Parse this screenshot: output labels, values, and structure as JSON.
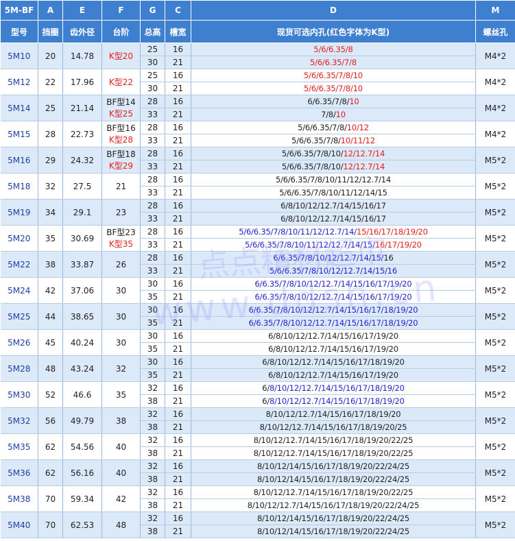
{
  "header_letters": [
    "5M-BF",
    "A",
    "E",
    "F",
    "G",
    "C",
    "D",
    "M"
  ],
  "header_names": [
    "型号",
    "挡圈",
    "齿外径",
    "台阶",
    "总高",
    "槽宽",
    "现货可选内孔(红色字体为K型)",
    "螺丝孔"
  ],
  "colors": {
    "header_bg": "#3f7fd0",
    "band_even": "#dce9f9",
    "band_odd": "#ffffff",
    "red": "#e31d1d",
    "blue": "#2222cc",
    "model": "#1f3fa8"
  },
  "watermark": {
    "line1": "点点精材超市",
    "line2": "www.ddsh.cn"
  },
  "groups": [
    {
      "model": "5M10",
      "a": "20",
      "e": "14.78",
      "f": [
        [
          "K型",
          "red"
        ],
        [
          "20",
          "red"
        ]
      ],
      "m": "M4*2",
      "rows": [
        {
          "g": "25",
          "c": "16",
          "d": [
            [
              "5/6/6.35/8",
              "red"
            ]
          ]
        },
        {
          "g": "30",
          "c": "21",
          "d": [
            [
              "5/6/6.35/7/8",
              "red"
            ]
          ]
        }
      ]
    },
    {
      "model": "5M12",
      "a": "22",
      "e": "17.96",
      "f": [
        [
          "K型",
          "red"
        ],
        [
          "22",
          "red"
        ]
      ],
      "m": "M4*2",
      "rows": [
        {
          "g": "25",
          "c": "16",
          "d": [
            [
              "5/6/6.35/7/8/10",
              "red"
            ]
          ]
        },
        {
          "g": "30",
          "c": "21",
          "d": [
            [
              "5/6/6.35/7/8/10",
              "red"
            ]
          ]
        }
      ]
    },
    {
      "model": "5M14",
      "a": "25",
      "e": "21.14",
      "f2": [
        [
          [
            "BF型14",
            "blk"
          ]
        ],
        [
          [
            "K型25",
            "red"
          ]
        ]
      ],
      "m": "M4*2",
      "rows": [
        {
          "g": "28",
          "c": "16",
          "d": [
            [
              "6/6.35/7/8/",
              "blk"
            ],
            [
              "10",
              "red"
            ]
          ]
        },
        {
          "g": "33",
          "c": "21",
          "d": [
            [
              "7/8/",
              "blk"
            ],
            [
              "10",
              "red"
            ]
          ]
        }
      ]
    },
    {
      "model": "5M15",
      "a": "28",
      "e": "22.73",
      "f2": [
        [
          [
            "BF型16",
            "blk"
          ]
        ],
        [
          [
            "K型28",
            "red"
          ]
        ]
      ],
      "m": "M4*2",
      "rows": [
        {
          "g": "28",
          "c": "16",
          "d": [
            [
              "5/6/6.35/7/8/",
              "blk"
            ],
            [
              "10/12",
              "red"
            ]
          ]
        },
        {
          "g": "33",
          "c": "21",
          "d": [
            [
              "5/6/6.35/7/8/",
              "blk"
            ],
            [
              "10/11/12",
              "red"
            ]
          ]
        }
      ]
    },
    {
      "model": "5M16",
      "a": "29",
      "e": "24.32",
      "f2": [
        [
          [
            "BF型18",
            "blk"
          ]
        ],
        [
          [
            "K型29",
            "red"
          ]
        ]
      ],
      "m": "M5*2",
      "rows": [
        {
          "g": "28",
          "c": "16",
          "d": [
            [
              "5/6/6.35/7/8/10/",
              "blk"
            ],
            [
              "12/12.7/14",
              "red"
            ]
          ]
        },
        {
          "g": "33",
          "c": "21",
          "d": [
            [
              "5/6/6.35/7/8/10/",
              "blk"
            ],
            [
              "12/12.7/14",
              "red"
            ]
          ]
        }
      ]
    },
    {
      "model": "5M18",
      "a": "32",
      "e": "27.5",
      "f": [
        [
          "21",
          "blk"
        ]
      ],
      "m": "M5*2",
      "rows": [
        {
          "g": "28",
          "c": "16",
          "d": [
            [
              "5/6/6.35/7/8/10/11/12/12.7/14",
              "blk"
            ]
          ]
        },
        {
          "g": "33",
          "c": "21",
          "d": [
            [
              "5/6/6.35/7/8/10/11/12/14/15",
              "blk"
            ]
          ]
        }
      ]
    },
    {
      "model": "5M19",
      "a": "34",
      "e": "29.1",
      "f": [
        [
          "23",
          "blk"
        ]
      ],
      "m": "M5*2",
      "rows": [
        {
          "g": "28",
          "c": "16",
          "d": [
            [
              "6/8/10/12/12.7/14/15/16/17",
              "blk"
            ]
          ]
        },
        {
          "g": "33",
          "c": "21",
          "d": [
            [
              "6/8/10/12/12.7/14/15/16/17",
              "blk"
            ]
          ]
        }
      ]
    },
    {
      "model": "5M20",
      "a": "35",
      "e": "30.69",
      "f2": [
        [
          [
            "BF型23",
            "blk"
          ]
        ],
        [
          [
            "K型35",
            "red"
          ]
        ]
      ],
      "m": "M5*2",
      "rows": [
        {
          "g": "28",
          "c": "16",
          "d": [
            [
              "5/6/6.35/7/8/10/11/12/12.7/14/",
              "blue"
            ],
            [
              "15/16/17/18/19/20",
              "red"
            ]
          ]
        },
        {
          "g": "33",
          "c": "21",
          "d": [
            [
              "5/6/6.35/7/8/10/11/12/12.7/14/15/",
              "blue"
            ],
            [
              "16/17/19/20",
              "red"
            ]
          ]
        }
      ]
    },
    {
      "model": "5M22",
      "a": "38",
      "e": "33.87",
      "f": [
        [
          "26",
          "blk"
        ]
      ],
      "m": "M5*2",
      "rows": [
        {
          "g": "28",
          "c": "16",
          "d": [
            [
              "6/6.35/7/8/10/12/12.7/14/15/",
              "blue"
            ],
            [
              "16",
              "blk"
            ]
          ]
        },
        {
          "g": "33",
          "c": "21",
          "d": [
            [
              "5/6/6.35/7/8/10/12/12.7/14/15/16",
              "blue"
            ]
          ]
        }
      ]
    },
    {
      "model": "5M24",
      "a": "42",
      "e": "37.06",
      "f": [
        [
          "30",
          "blk"
        ]
      ],
      "m": "M5*2",
      "rows": [
        {
          "g": "30",
          "c": "16",
          "d": [
            [
              "6/6.35/7/8/10/12/12.7/14/15/16/17/19/20",
              "blue"
            ]
          ]
        },
        {
          "g": "35",
          "c": "21",
          "d": [
            [
              "6/6.35/7/8/10/12/12.7/14/15/16/17/19/20",
              "blue"
            ]
          ]
        }
      ]
    },
    {
      "model": "5M25",
      "a": "44",
      "e": "38.65",
      "f": [
        [
          "30",
          "blk"
        ]
      ],
      "m": "M5*2",
      "rows": [
        {
          "g": "30",
          "c": "16",
          "d": [
            [
              "6/6.35/7/8/10/12/12.7/14/15/16/17/18/19/20",
              "blue"
            ]
          ]
        },
        {
          "g": "35",
          "c": "21",
          "d": [
            [
              "6/6.35/7/8/10/12/12.7/14/15/16/17/18/19/20",
              "blue"
            ]
          ]
        }
      ]
    },
    {
      "model": "5M26",
      "a": "45",
      "e": "40.24",
      "f": [
        [
          "30",
          "blk"
        ]
      ],
      "m": "M5*2",
      "rows": [
        {
          "g": "30",
          "c": "16",
          "d": [
            [
              "6/8/10/12/12.7/14/15/16/17/19/20",
              "blk"
            ]
          ]
        },
        {
          "g": "35",
          "c": "21",
          "d": [
            [
              "6/8/10/12/12.7/14/15/16/17/19/20",
              "blk"
            ]
          ]
        }
      ]
    },
    {
      "model": "5M28",
      "a": "48",
      "e": "43.24",
      "f": [
        [
          "32",
          "blk"
        ]
      ],
      "m": "M5*2",
      "rows": [
        {
          "g": "30",
          "c": "16",
          "d": [
            [
              "6/8/10/12/12.7/14/15/16/17/18/19/20",
              "blk"
            ]
          ]
        },
        {
          "g": "35",
          "c": "21",
          "d": [
            [
              "6/8/10/12/12.7/14/15/16/17/19/20",
              "blk"
            ]
          ]
        }
      ]
    },
    {
      "model": "5M30",
      "a": "52",
      "e": "46.6",
      "f": [
        [
          "35",
          "blk"
        ]
      ],
      "m": "M5*2",
      "rows": [
        {
          "g": "32",
          "c": "16",
          "d": [
            [
              "6/",
              "blk"
            ],
            [
              "8/10/12/12.7/14/15/16/17/18/19/20",
              "blue"
            ]
          ]
        },
        {
          "g": "38",
          "c": "21",
          "d": [
            [
              "6/",
              "blk"
            ],
            [
              "8/10/12/12.7/14/15/16/17/18/19/20",
              "blue"
            ]
          ]
        }
      ]
    },
    {
      "model": "5M32",
      "a": "56",
      "e": "49.79",
      "f": [
        [
          "38",
          "blk"
        ]
      ],
      "m": "M5*2",
      "rows": [
        {
          "g": "32",
          "c": "16",
          "d": [
            [
              "8/10/12/12.7/14/15/16/17/18/19/20",
              "blk"
            ]
          ]
        },
        {
          "g": "38",
          "c": "21",
          "d": [
            [
              "8/10/12/12.7/14/15/16/17/18/19/20/25",
              "blk"
            ]
          ]
        }
      ]
    },
    {
      "model": "5M35",
      "a": "62",
      "e": "54.56",
      "f": [
        [
          "40",
          "blk"
        ]
      ],
      "m": "M5*2",
      "rows": [
        {
          "g": "32",
          "c": "16",
          "d": [
            [
              "8/10/12/12.7/14/15/16/17/18/19/20/22/25",
              "blk"
            ]
          ]
        },
        {
          "g": "38",
          "c": "21",
          "d": [
            [
              "8/10/12/12.7/14/15/16/17/18/19/20/22/25",
              "blk"
            ]
          ]
        }
      ]
    },
    {
      "model": "5M36",
      "a": "62",
      "e": "56.16",
      "f": [
        [
          "40",
          "blk"
        ]
      ],
      "m": "M5*2",
      "rows": [
        {
          "g": "32",
          "c": "16",
          "d": [
            [
              "8/10/12/14/15/16/17/18/19/20/22/24/25",
              "blk"
            ]
          ]
        },
        {
          "g": "38",
          "c": "21",
          "d": [
            [
              "8/10/12/14/15/16/17/18/19/20/22/24/25",
              "blk"
            ]
          ]
        }
      ]
    },
    {
      "model": "5M38",
      "a": "70",
      "e": "59.34",
      "f": [
        [
          "42",
          "blk"
        ]
      ],
      "m": "M5*2",
      "rows": [
        {
          "g": "32",
          "c": "16",
          "d": [
            [
              "8/10/12/12.7/14/15/16/17/18/19/20/22/25",
              "blk"
            ]
          ]
        },
        {
          "g": "38",
          "c": "21",
          "d": [
            [
              "8/10/12/12.7/14/15/16/17/18/19/20/22/24/25",
              "blk"
            ]
          ]
        }
      ]
    },
    {
      "model": "5M40",
      "a": "70",
      "e": "62.53",
      "f": [
        [
          "48",
          "blk"
        ]
      ],
      "m": "M5*2",
      "rows": [
        {
          "g": "32",
          "c": "16",
          "d": [
            [
              "8/10/12/14/15/16/17/18/19/20/22/24/25",
              "blk"
            ]
          ]
        },
        {
          "g": "38",
          "c": "21",
          "d": [
            [
              "8/10/12/14/15/16/17/18/19/20/22/24/25",
              "blk"
            ]
          ]
        }
      ]
    }
  ]
}
